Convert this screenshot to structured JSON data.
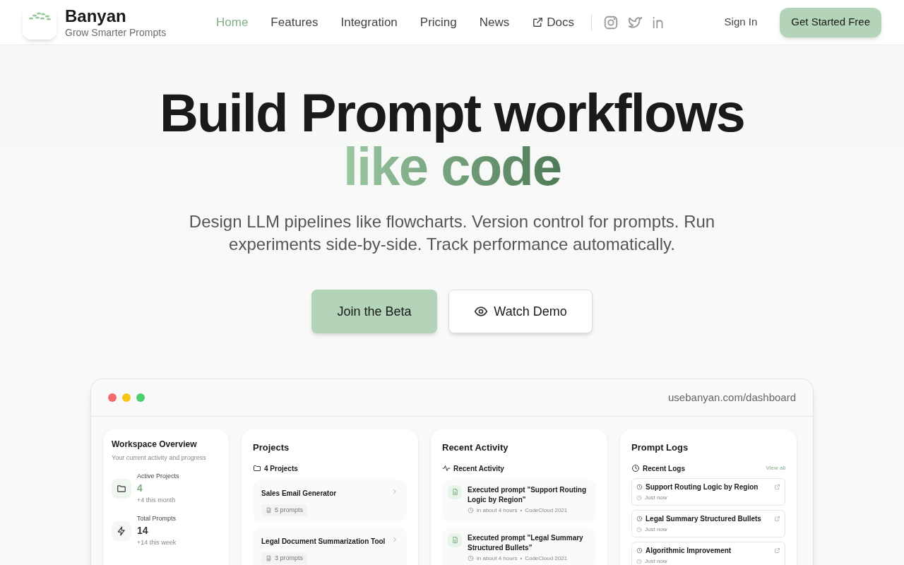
{
  "brand": {
    "name": "Banyan",
    "tagline": "Grow Smarter Prompts"
  },
  "nav": [
    {
      "label": "Home",
      "selected": true,
      "external": false
    },
    {
      "label": "Features",
      "selected": false,
      "external": false
    },
    {
      "label": "Integration",
      "selected": false,
      "external": false
    },
    {
      "label": "Pricing",
      "selected": false,
      "external": false
    },
    {
      "label": "News",
      "selected": false,
      "external": false
    },
    {
      "label": "Docs",
      "selected": false,
      "external": true
    }
  ],
  "sign_in": "Sign In",
  "cta": "Get Started Free",
  "hero": {
    "title_line1": "Build Prompt workflows",
    "title_line2": "like code",
    "subtitle": "Design LLM pipelines like flowcharts. Version control for prompts. Run experiments side-by-side. Track performance automatically.",
    "primary_button": "Join the Beta",
    "secondary_button": "Watch Demo"
  },
  "browser": {
    "url": "usebanyan.com/dashboard"
  },
  "overview": {
    "title": "Workspace Overview",
    "subtitle": "Your current activity and progress",
    "stats": [
      {
        "kind": "folder",
        "label": "Active Projects",
        "value": "4",
        "change": "+4 this month"
      },
      {
        "kind": "bolt",
        "label": "Total Prompts",
        "value": "14",
        "change": "+14 this week"
      }
    ]
  },
  "projects": {
    "title": "Projects",
    "count": "4 Projects",
    "items": [
      {
        "name": "Sales Email Generator",
        "prompts": "5 prompts"
      },
      {
        "name": "Legal Document Summarization Tool",
        "prompts": "3 prompts"
      }
    ]
  },
  "activity": {
    "title": "Recent Activity",
    "subtitle": "Recent Activity",
    "items": [
      {
        "text": "Executed prompt \"Support Routing Logic by Region\"",
        "time": "in about 4 hours",
        "separator": "•",
        "source": "CodeCloud 2021"
      },
      {
        "text": "Executed prompt \"Legal Summary Structured Bullets\"",
        "time": "in about 4 hours",
        "separator": "•",
        "source": "CodeCloud 2021"
      }
    ]
  },
  "logs": {
    "title": "Prompt Logs",
    "subtitle": "Recent Logs",
    "view_all": "View all",
    "items": [
      {
        "name": "Support Routing Logic by Region",
        "time": "Just now"
      },
      {
        "name": "Legal Summary Structured Bullets",
        "time": "Just now"
      },
      {
        "name": "Algorithmic Improvement",
        "time": "Just now"
      }
    ]
  }
}
